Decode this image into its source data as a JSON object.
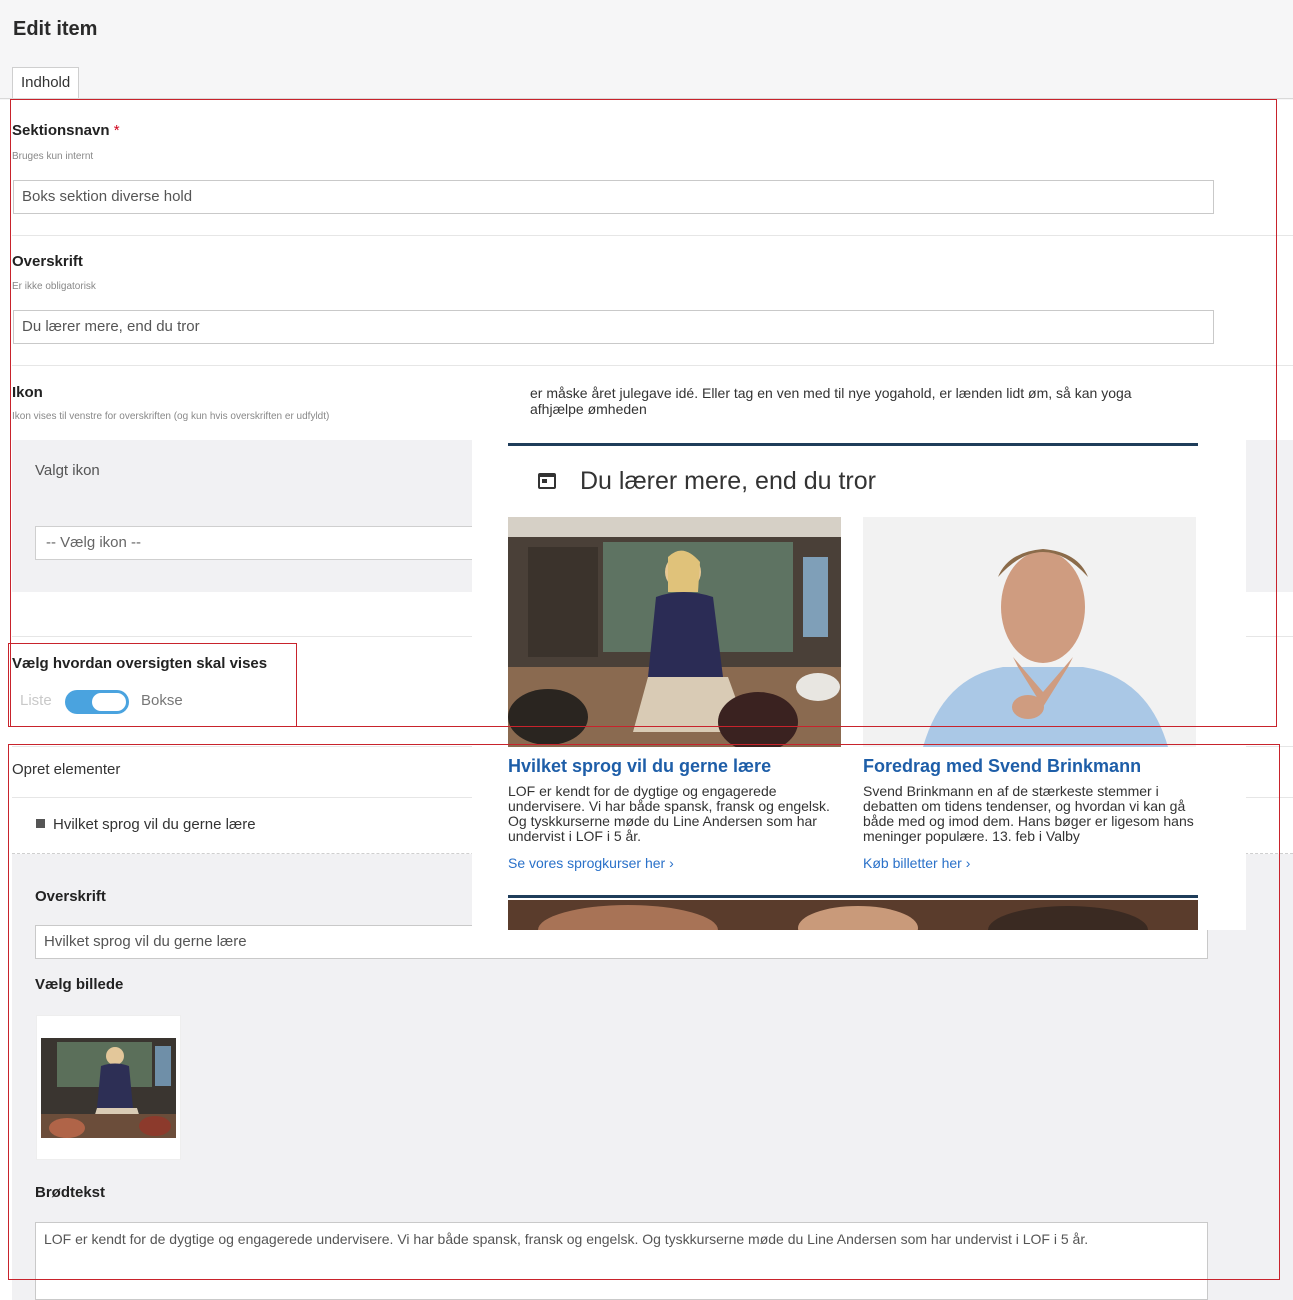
{
  "page": {
    "title": "Edit item",
    "tab_label": "Indhold"
  },
  "fields": {
    "sektionsnavn": {
      "label": "Sektionsnavn",
      "required_mark": "*",
      "description": "Bruges kun internt",
      "value": "Boks sektion diverse hold"
    },
    "overskrift": {
      "label": "Overskrift",
      "description": "Er ikke obligatorisk",
      "value": "Du lærer mere, end du tror"
    },
    "ikon": {
      "label": "Ikon",
      "description": "Ikon vises til venstre for overskriften (og kun hvis overskriften er udfyldt)",
      "selected_label": "Valgt ikon",
      "select_value": "-- Vælg ikon --"
    },
    "visning": {
      "label": "Vælg hvordan oversigten skal vises",
      "off_label": "Liste",
      "on_label": "Bokse",
      "state": "Bokse"
    }
  },
  "elements": {
    "section_label": "Opret elementer",
    "item_title": "Hvilket sprog vil du gerne lære",
    "overskrift_label": "Overskrift",
    "overskrift_value": "Hvilket sprog vil du gerne lære",
    "billede_label": "Vælg billede",
    "brodtekst_label": "Brødtekst",
    "brodtekst_value": "LOF er kendt for de dygtige og engagerede undervisere. Vi har både spansk, fransk og engelsk. Og tyskkurserne møde du Line Andersen som har undervist i LOF i 5 år."
  },
  "preview": {
    "intro": "er måske året julegave idé. Eller tag en ven med til nye yogahold, er lænden lidt øm, så kan yoga afhjælpe ømheden",
    "heading": "Du lærer mere, end du tror",
    "icon": "calendar-icon",
    "cards": [
      {
        "title": "Hvilket sprog vil du gerne lære",
        "text": "LOF er kendt for de dygtige og engagerede undervisere. Vi har både spansk, fransk og engelsk. Og tyskkurserne møde du Line Andersen som har undervist i LOF i 5 år.",
        "link": "Se vores sprogkurser her  ›"
      },
      {
        "title": "Foredrag med Svend Brinkmann",
        "text": "Svend Brinkmann en af de stærkeste stemmer i debatten om tidens tendenser, og hvordan vi kan gå både med og imod dem. Hans bøger er ligesom hans meninger populære. 13. feb i Valby",
        "link": "Køb billetter her  ›"
      }
    ]
  },
  "colors": {
    "accent": "#4aa3df",
    "annotation": "#c8232c",
    "link": "#1e5ea8",
    "rule": "#1f3d5a"
  }
}
